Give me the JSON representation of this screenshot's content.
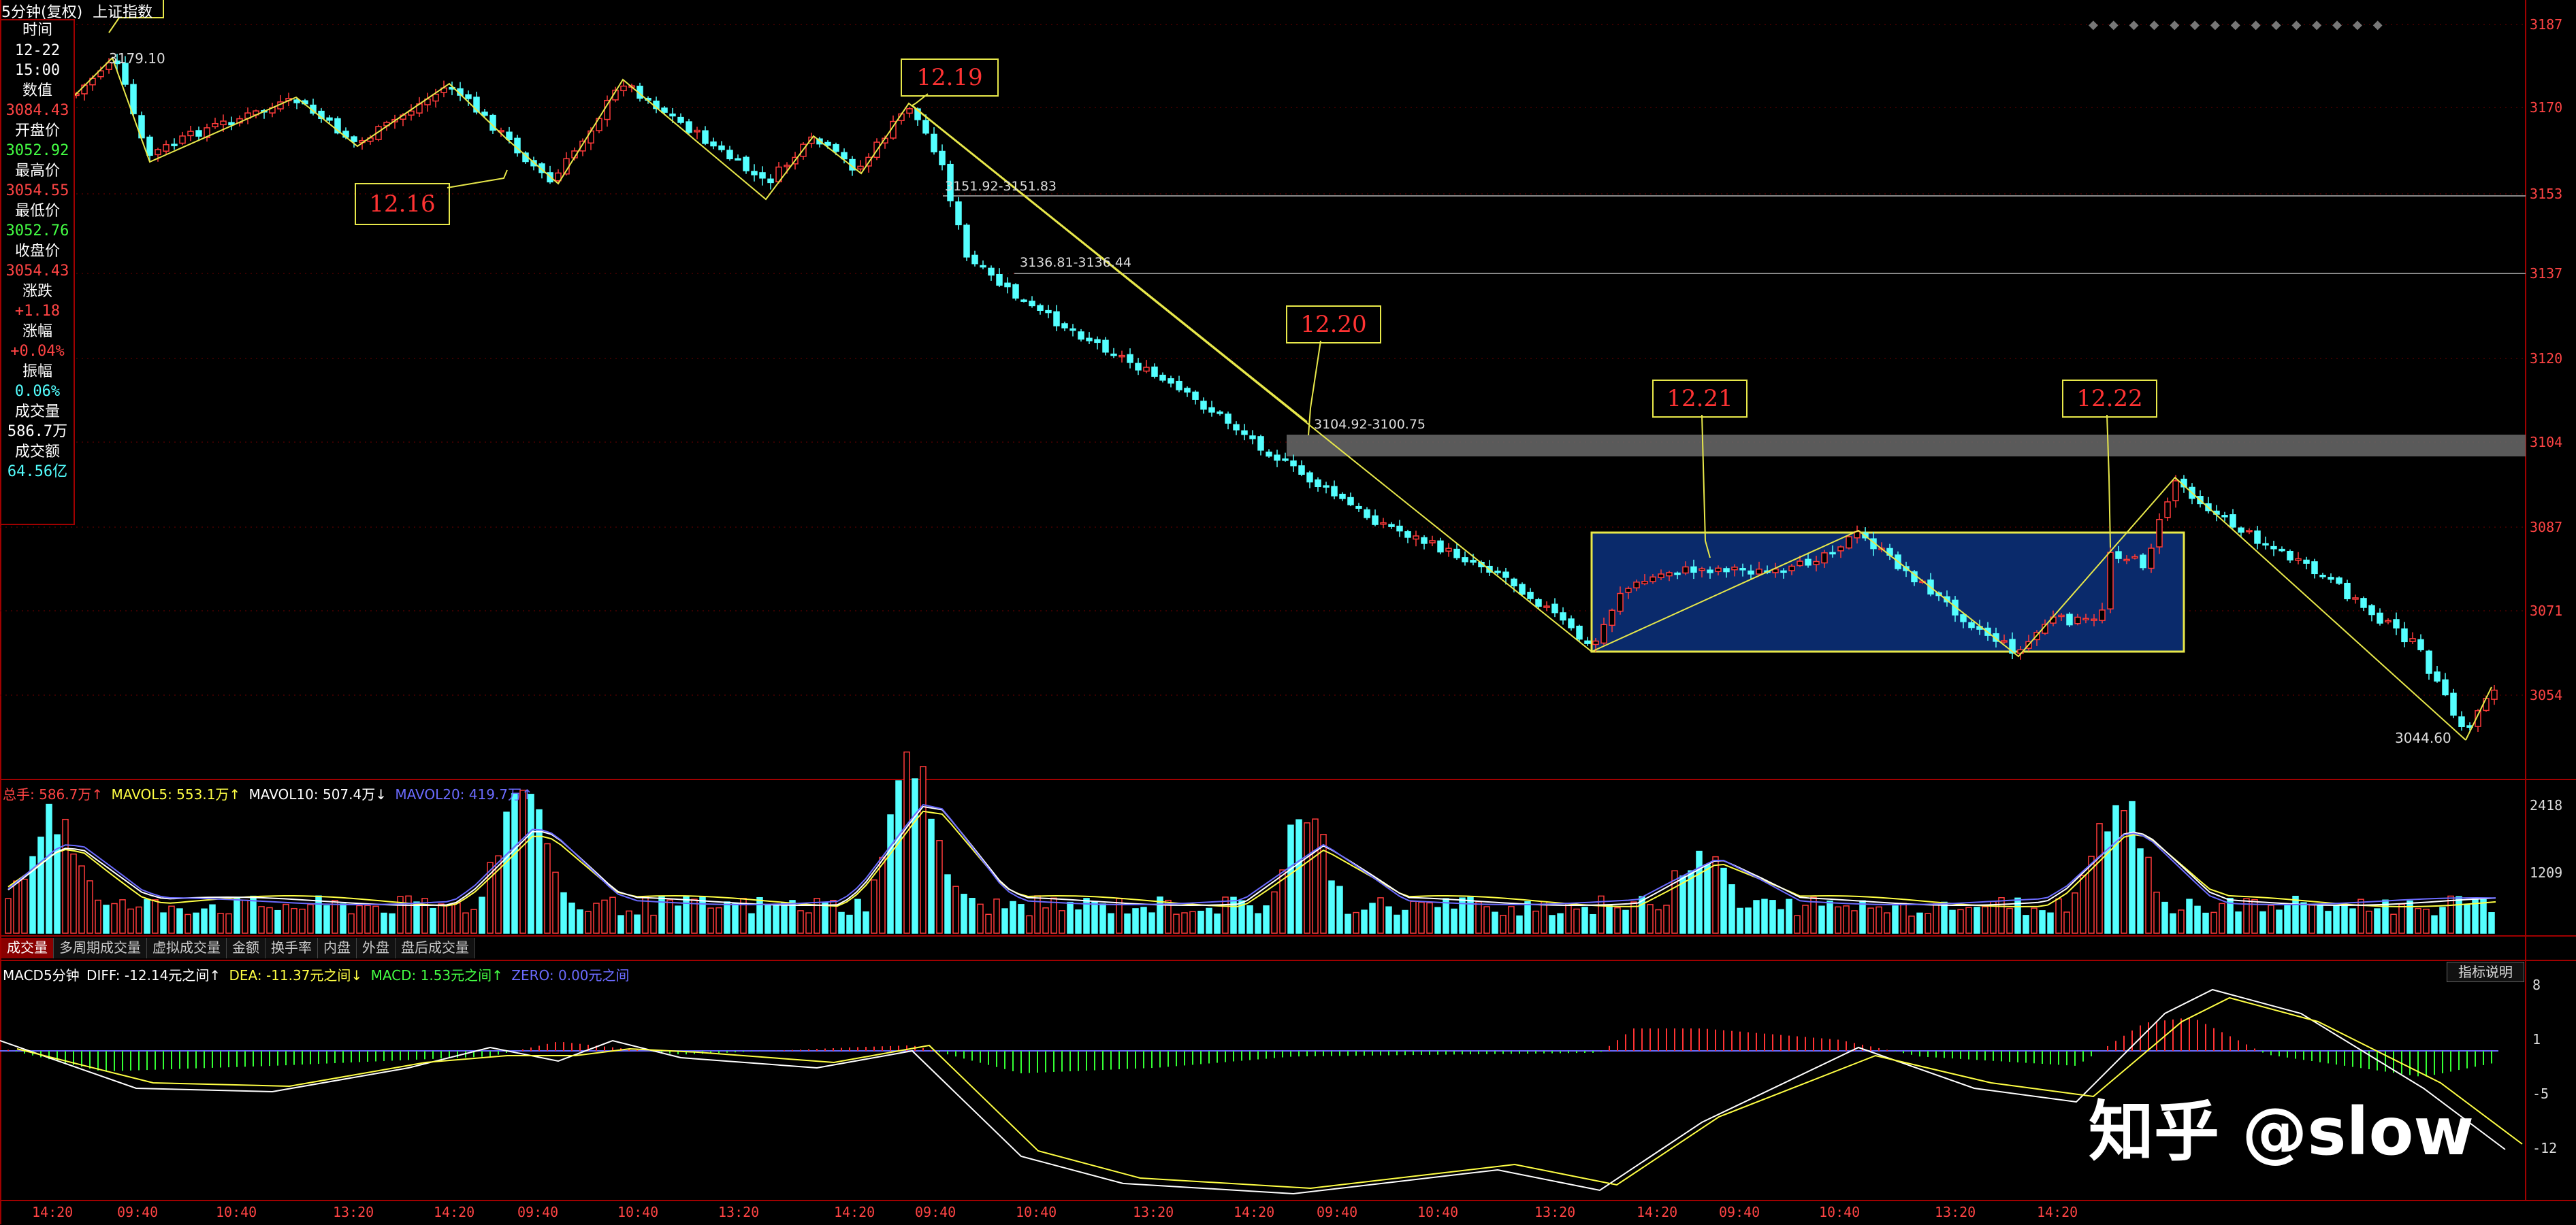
{
  "header": {
    "period_label": "5分钟(复权)",
    "index_name": "上证指数"
  },
  "info_panel": [
    {
      "label": "时间",
      "value": "12-22"
    },
    {
      "label": "",
      "value": "15:00"
    },
    {
      "label": "数值",
      "value": "3084.43"
    },
    {
      "label": "开盘价",
      "value": "3052.92"
    },
    {
      "label": "最高价",
      "value": "3054.55"
    },
    {
      "label": "最低价",
      "value": "3052.76"
    },
    {
      "label": "收盘价",
      "value": "3054.43"
    },
    {
      "label": "涨跌",
      "value": "+1.18"
    },
    {
      "label": "涨幅",
      "value": "+0.04%"
    },
    {
      "label": "振幅",
      "value": "0.06%"
    },
    {
      "label": "成交量",
      "value": "586.7万"
    },
    {
      "label": "成交额",
      "value": "64.56亿"
    }
  ],
  "price_axis": [
    "3187",
    "3170",
    "3153",
    "3137",
    "3120",
    "3104",
    "3087",
    "3071",
    "3054"
  ],
  "volume_axis": [
    "2418",
    "1209"
  ],
  "macd_axis": [
    "8",
    "1",
    "-5",
    "-12"
  ],
  "time_axis": [
    "14:20",
    "09:40",
    "10:40",
    "13:20",
    "14:20",
    "09:40",
    "10:40",
    "13:20",
    "14:20",
    "09:40",
    "10:40",
    "13:20",
    "14:20",
    "09:40",
    "10:40",
    "13:20",
    "14:20",
    "09:40",
    "10:40",
    "13:20",
    "14:20"
  ],
  "annotations": {
    "high_label": "3179.10",
    "low_label": "3044.60",
    "gap1": "3151.92-3151.83",
    "gap2": "3136.81-3136.44",
    "gap3": "3104.92-3100.75",
    "date_boxes": [
      "12.16",
      "12.19",
      "12.20",
      "12.21",
      "12.22"
    ]
  },
  "volume_legend": {
    "total": "总手: 586.7万↑",
    "mavol5": "MAVOL5: 553.1万↑",
    "mavol10": "MAVOL10: 507.4万↓",
    "mavol20": "MAVOL20: 419.7万↑"
  },
  "bottom_tabs": [
    "成交量",
    "多周期成交量",
    "虚拟成交量",
    "金额",
    "换手率",
    "内盘",
    "外盘",
    "盘后成交量"
  ],
  "macd_legend": {
    "name": "MACD5分钟",
    "diff": "DIFF: -12.14元之间↑",
    "dea": "DEA: -11.37元之间↓",
    "macd": "MACD: 1.53元之间↑",
    "zero": "ZERO: 0.00元之间"
  },
  "help_button": "指标说明",
  "watermark": "知乎 @slow",
  "colors": {
    "up": "#ff3b3b",
    "down": "#54ffff",
    "axis_red": "#b00000",
    "yellow": "#ffff44",
    "box_fill": "#0a2a6b"
  }
}
